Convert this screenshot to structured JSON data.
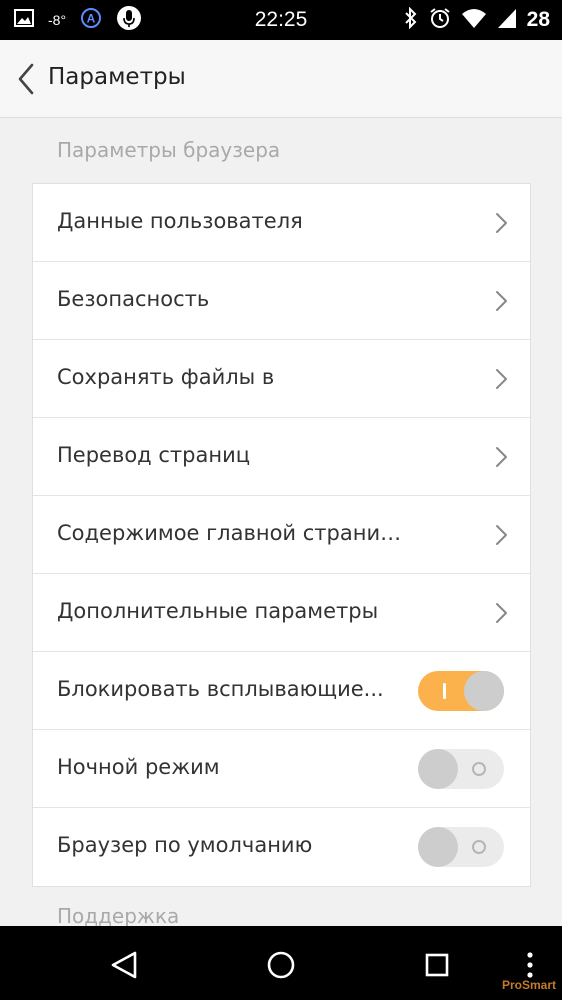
{
  "status_bar": {
    "time": "22:25",
    "temperature": "-8°",
    "battery": "28",
    "left_icons": [
      "image-icon",
      "temperature-icon",
      "browser-a-icon",
      "microphone-icon"
    ],
    "right_icons": [
      "bluetooth-icon",
      "alarm-icon",
      "wifi-icon",
      "signal-icon"
    ]
  },
  "header": {
    "title": "Параметры"
  },
  "sections": [
    {
      "title": "Параметры браузера",
      "items": [
        {
          "label": "Данные пользователя",
          "type": "link"
        },
        {
          "label": "Безопасность",
          "type": "link"
        },
        {
          "label": "Сохранять файлы в",
          "type": "link"
        },
        {
          "label": "Перевод страниц",
          "type": "link"
        },
        {
          "label": "Содержимое главной страницы",
          "type": "link"
        },
        {
          "label": "Дополнительные параметры",
          "type": "link"
        },
        {
          "label": "Блокировать всплывающие...",
          "type": "toggle",
          "on": true
        },
        {
          "label": "Ночной режим",
          "type": "toggle",
          "on": false
        },
        {
          "label": "Браузер по умолчанию",
          "type": "toggle",
          "on": false
        }
      ]
    },
    {
      "title": "Поддержка"
    }
  ],
  "watermark": "ProSmart",
  "colors": {
    "toggle_on": "#fbb24d",
    "toggle_off": "#ebebeb",
    "section_title": "#a9a9a9"
  }
}
